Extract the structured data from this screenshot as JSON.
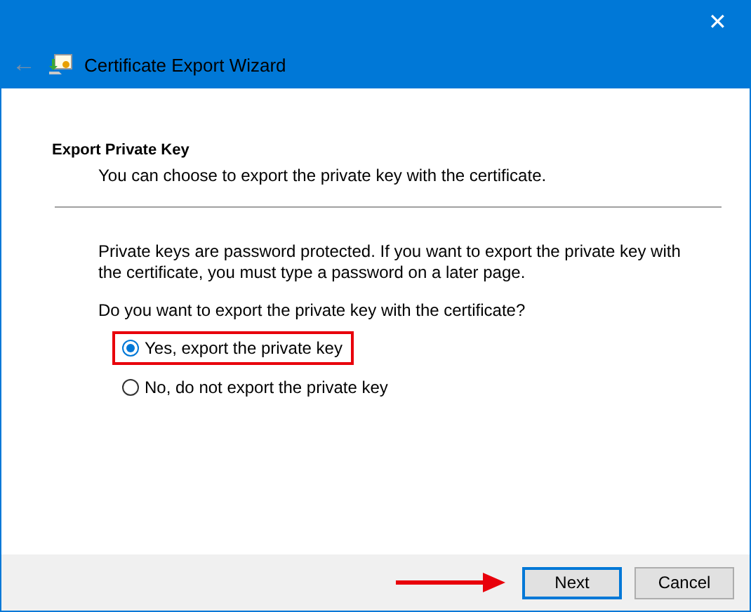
{
  "window": {
    "title": "Certificate Export Wizard",
    "close": "✕",
    "back": "←"
  },
  "header": {
    "title": "Export Private Key",
    "subtitle": "You can choose to export the private key with the certificate."
  },
  "body": {
    "paragraph": "Private keys are password protected. If you want to export the private key with the certificate, you must type a password on a later page.",
    "question": "Do you want to export the private key with the certificate?"
  },
  "options": [
    {
      "label": "Yes, export the private key",
      "selected": true,
      "highlighted": true
    },
    {
      "label": "No, do not export the private key",
      "selected": false,
      "highlighted": false
    }
  ],
  "buttons": [
    {
      "label": "Next",
      "default": true,
      "arrow": true
    },
    {
      "label": "Cancel",
      "default": false,
      "arrow": false
    }
  ]
}
